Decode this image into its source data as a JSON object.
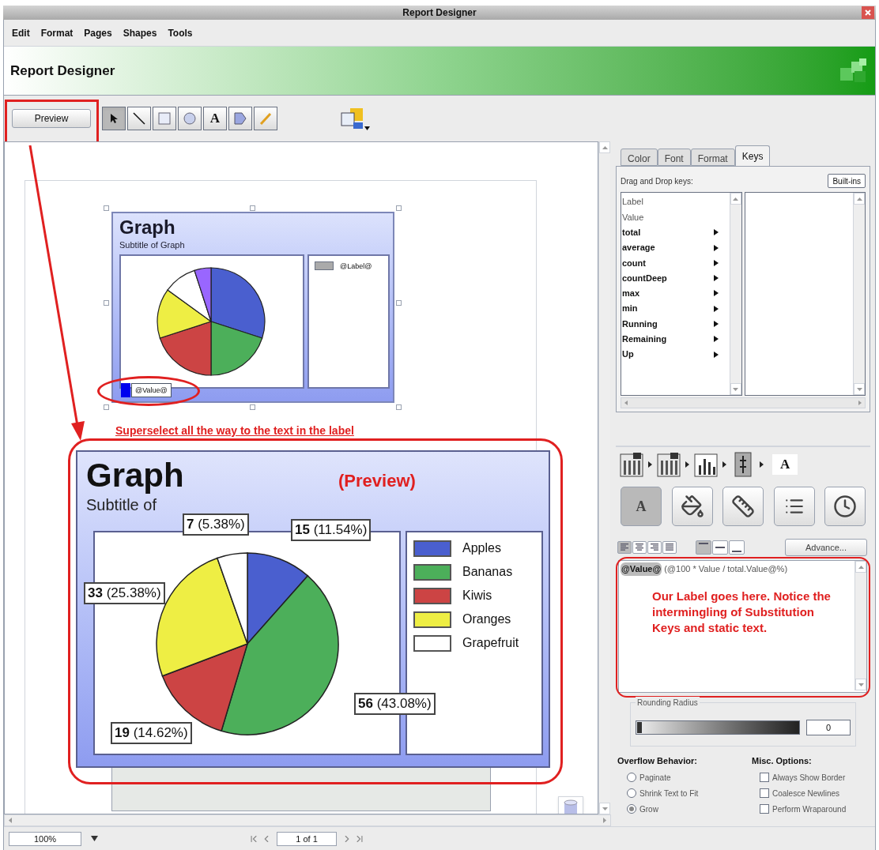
{
  "window": {
    "title": "Report Designer"
  },
  "menu": [
    "Edit",
    "Format",
    "Pages",
    "Shapes",
    "Tools"
  ],
  "header": {
    "title": "Report Designer"
  },
  "toolbar": {
    "preview_button": "Preview",
    "tools": [
      {
        "kind": "arrow",
        "selected": true
      },
      {
        "kind": "line",
        "selected": false
      },
      {
        "kind": "rect",
        "selected": false
      },
      {
        "kind": "ellipse",
        "selected": false
      },
      {
        "kind": "text",
        "label": "A",
        "selected": false
      },
      {
        "kind": "polygon",
        "selected": false
      },
      {
        "kind": "pen",
        "selected": false
      }
    ]
  },
  "canvas": {
    "design_graph": {
      "title": "Graph",
      "subtitle": "Subtitle of Graph",
      "legend_label": "@Label@",
      "value_label": "@Value@"
    },
    "annotation": "Superselect all the way to the text in the label",
    "preview_graph": {
      "title": "Graph",
      "tag": "(Preview)",
      "subtitle": "Subtitle of",
      "chart_data": {
        "type": "pie",
        "categories": [
          "Apples",
          "Bananas",
          "Kiwis",
          "Oranges",
          "Grapefruit"
        ],
        "values": [
          11.54,
          43.08,
          14.62,
          25.38,
          5.38
        ],
        "colors": [
          "#4a5fcf",
          "#4caf5a",
          "#cc4444",
          "#eeee44",
          "#ffffff"
        ],
        "value_labels": [
          "**15** (11.54%)",
          "**56** (43.08%)",
          "**19** (14.62%)",
          "**33** (25.38%)",
          "**7** (5.38%)"
        ]
      }
    }
  },
  "tabs": [
    {
      "label": "Color",
      "selected": false
    },
    {
      "label": "Font",
      "selected": false
    },
    {
      "label": "Format",
      "selected": false
    },
    {
      "label": "Keys",
      "selected": true
    }
  ],
  "keys_panel": {
    "hint": "Drag and Drop keys:",
    "builtins_button": "Built-ins",
    "keys": [
      {
        "label": "Label",
        "kind": "field"
      },
      {
        "label": "Value",
        "kind": "field"
      },
      {
        "label": "total",
        "kind": "group"
      },
      {
        "label": "average",
        "kind": "group"
      },
      {
        "label": "count",
        "kind": "group"
      },
      {
        "label": "countDeep",
        "kind": "group"
      },
      {
        "label": "max",
        "kind": "group"
      },
      {
        "label": "min",
        "kind": "group"
      },
      {
        "label": "Running",
        "kind": "group"
      },
      {
        "label": "Remaining",
        "kind": "group"
      },
      {
        "label": "Up",
        "kind": "group"
      }
    ]
  },
  "breadcrumb": {
    "last_label": "A"
  },
  "style_buttons": [
    {
      "kind": "text",
      "label": "A",
      "selected": true
    },
    {
      "kind": "fill",
      "selected": false
    },
    {
      "kind": "ruler",
      "selected": false
    },
    {
      "kind": "list",
      "selected": false
    },
    {
      "kind": "clock",
      "selected": false
    }
  ],
  "h_align": [
    {
      "kind": "left",
      "selected": true
    },
    {
      "kind": "center",
      "selected": false
    },
    {
      "kind": "right",
      "selected": false
    },
    {
      "kind": "justify",
      "selected": false
    }
  ],
  "v_align": [
    {
      "kind": "top",
      "selected": true
    },
    {
      "kind": "middle",
      "selected": false
    },
    {
      "kind": "bottom",
      "selected": false
    }
  ],
  "advance_button": "Advance...",
  "label_editor": {
    "tokens": [
      {
        "kind": "key",
        "text": "@Value@"
      },
      {
        "kind": "static",
        "text": "(@100 * Value / total.Value@%)"
      }
    ],
    "note": "Our Label goes here. Notice the intermingling of Substitution Keys and static text."
  },
  "rounding": {
    "title": "Rounding Radius",
    "level": 0,
    "value": "0"
  },
  "overflow": {
    "title": "Overflow Behavior:",
    "options": [
      {
        "label": "Paginate",
        "selected": false
      },
      {
        "label": "Shrink Text to Fit",
        "selected": false
      },
      {
        "label": "Grow",
        "selected": true
      }
    ]
  },
  "misc": {
    "title": "Misc. Options:",
    "options": [
      {
        "label": "Always Show Border",
        "checked": false
      },
      {
        "label": "Coalesce Newlines",
        "checked": false
      },
      {
        "label": "Perform Wraparound",
        "checked": false
      }
    ]
  },
  "status": {
    "zoom": "100%",
    "page": "1 of 1"
  }
}
